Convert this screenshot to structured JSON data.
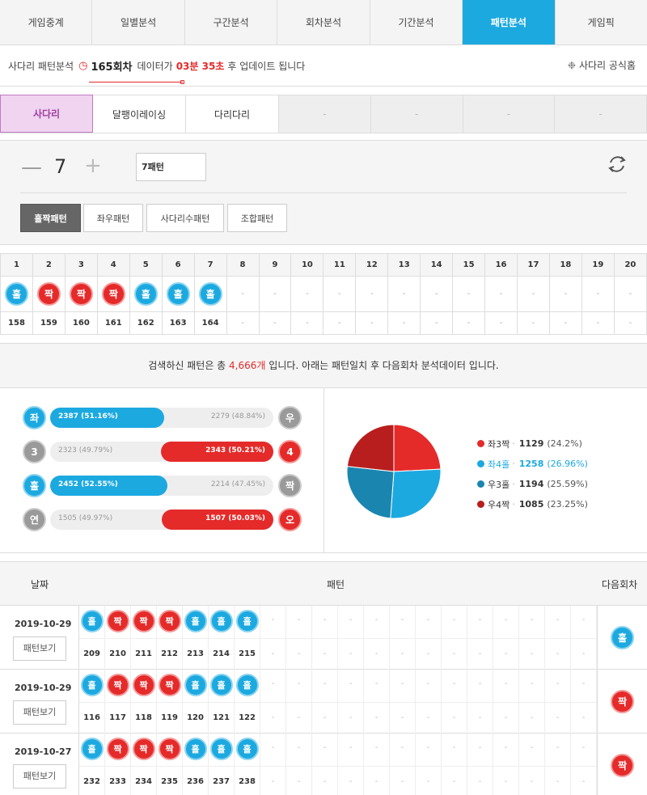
{
  "nav": {
    "tabs": [
      "게임중계",
      "일별분석",
      "구간분석",
      "회차분석",
      "기간분석",
      "패턴분석",
      "게임픽"
    ],
    "active_index": 5
  },
  "info": {
    "prefix": "사다리 패턴분석",
    "round": "165회차",
    "middle": "데이터가",
    "time": "03분 35초",
    "suffix": "후 업데이트 됩니다",
    "official_link": "사다리 공식홈"
  },
  "game_tabs": [
    "사다리",
    "달팽이레이싱",
    "다리다리"
  ],
  "empty_tab_label": "-",
  "control": {
    "minus": "—",
    "count": "7",
    "plus": "+",
    "pattern_value": "7패턴",
    "pattern_tabs": [
      "홀짝패턴",
      "좌우패턴",
      "사다리수패턴",
      "조합패턴"
    ],
    "active_pattern": 0
  },
  "pattern_grid": {
    "columns": [
      "1",
      "2",
      "3",
      "4",
      "5",
      "6",
      "7",
      "8",
      "9",
      "10",
      "11",
      "12",
      "13",
      "14",
      "15",
      "16",
      "17",
      "18",
      "19",
      "20"
    ],
    "balls": [
      "홀",
      "짝",
      "짝",
      "짝",
      "홀",
      "홀",
      "홀",
      "-",
      "-",
      "-",
      "-",
      "-",
      "-",
      "-",
      "-",
      "-",
      "-",
      "-",
      "-",
      "-"
    ],
    "rounds": [
      "158",
      "159",
      "160",
      "161",
      "162",
      "163",
      "164",
      "-",
      "-",
      "-",
      "-",
      "-",
      "-",
      "-",
      "-",
      "-",
      "-",
      "-",
      "-",
      "-"
    ]
  },
  "summary": {
    "before": "검색하신 패턴은 총",
    "count": "4,666개",
    "after": "입니다. 아래는 패턴일치 후 다음회차 분석데이터 입니다."
  },
  "bars": [
    {
      "left_label": "좌",
      "right_label": "우",
      "left_text": "2387 (51.16%)",
      "right_text": "2279 (48.84%)",
      "left_pct": 51.16,
      "right_pct": 48.84,
      "winner": "left",
      "left_color": "odd",
      "right_color": "grey"
    },
    {
      "left_label": "3",
      "right_label": "4",
      "left_text": "2323 (49.79%)",
      "right_text": "2343 (50.21%)",
      "left_pct": 49.79,
      "right_pct": 50.21,
      "winner": "right",
      "left_color": "grey",
      "right_color": "even"
    },
    {
      "left_label": "홀",
      "right_label": "짝",
      "left_text": "2452 (52.55%)",
      "right_text": "2214 (47.45%)",
      "left_pct": 52.55,
      "right_pct": 47.45,
      "winner": "left",
      "left_color": "odd",
      "right_color": "grey"
    },
    {
      "left_label": "연",
      "right_label": "오",
      "left_text": "1505 (49.97%)",
      "right_text": "1507 (50.03%)",
      "left_pct": 49.97,
      "right_pct": 50.03,
      "winner": "right",
      "left_color": "grey",
      "right_color": "even"
    }
  ],
  "chart_data": {
    "type": "pie",
    "categories": [
      "좌3짝",
      "좌4홀",
      "우3홀",
      "우4짝"
    ],
    "values": [
      1129,
      1258,
      1194,
      1085
    ],
    "percent_labels": [
      "(24.2%)",
      "(26.96%)",
      "(25.59%)",
      "(23.25%)"
    ],
    "colors": [
      "#e52a2a",
      "#1ca9e0",
      "#1a86b0",
      "#b81e1e"
    ],
    "highlight_index": 1
  },
  "history": {
    "header_date": "날짜",
    "header_pattern": "패턴",
    "header_next": "다음회차",
    "button_label": "패턴보기",
    "rows": [
      {
        "date": "2019-10-29",
        "balls": [
          "홀",
          "짝",
          "짝",
          "짝",
          "홀",
          "홀",
          "홀"
        ],
        "rounds": [
          "209",
          "210",
          "211",
          "212",
          "213",
          "214",
          "215"
        ],
        "next": "홀"
      },
      {
        "date": "2019-10-29",
        "balls": [
          "홀",
          "짝",
          "짝",
          "짝",
          "홀",
          "홀",
          "홀"
        ],
        "rounds": [
          "116",
          "117",
          "118",
          "119",
          "120",
          "121",
          "122"
        ],
        "next": "짝"
      },
      {
        "date": "2019-10-27",
        "balls": [
          "홀",
          "짝",
          "짝",
          "짝",
          "홀",
          "홀",
          "홀"
        ],
        "rounds": [
          "232",
          "233",
          "234",
          "235",
          "236",
          "237",
          "238"
        ],
        "next": "짝"
      }
    ],
    "dash": "-"
  },
  "colors": {
    "odd": "#1ca9e0",
    "even": "#e52a2a",
    "accent": "#1ca9e0"
  }
}
